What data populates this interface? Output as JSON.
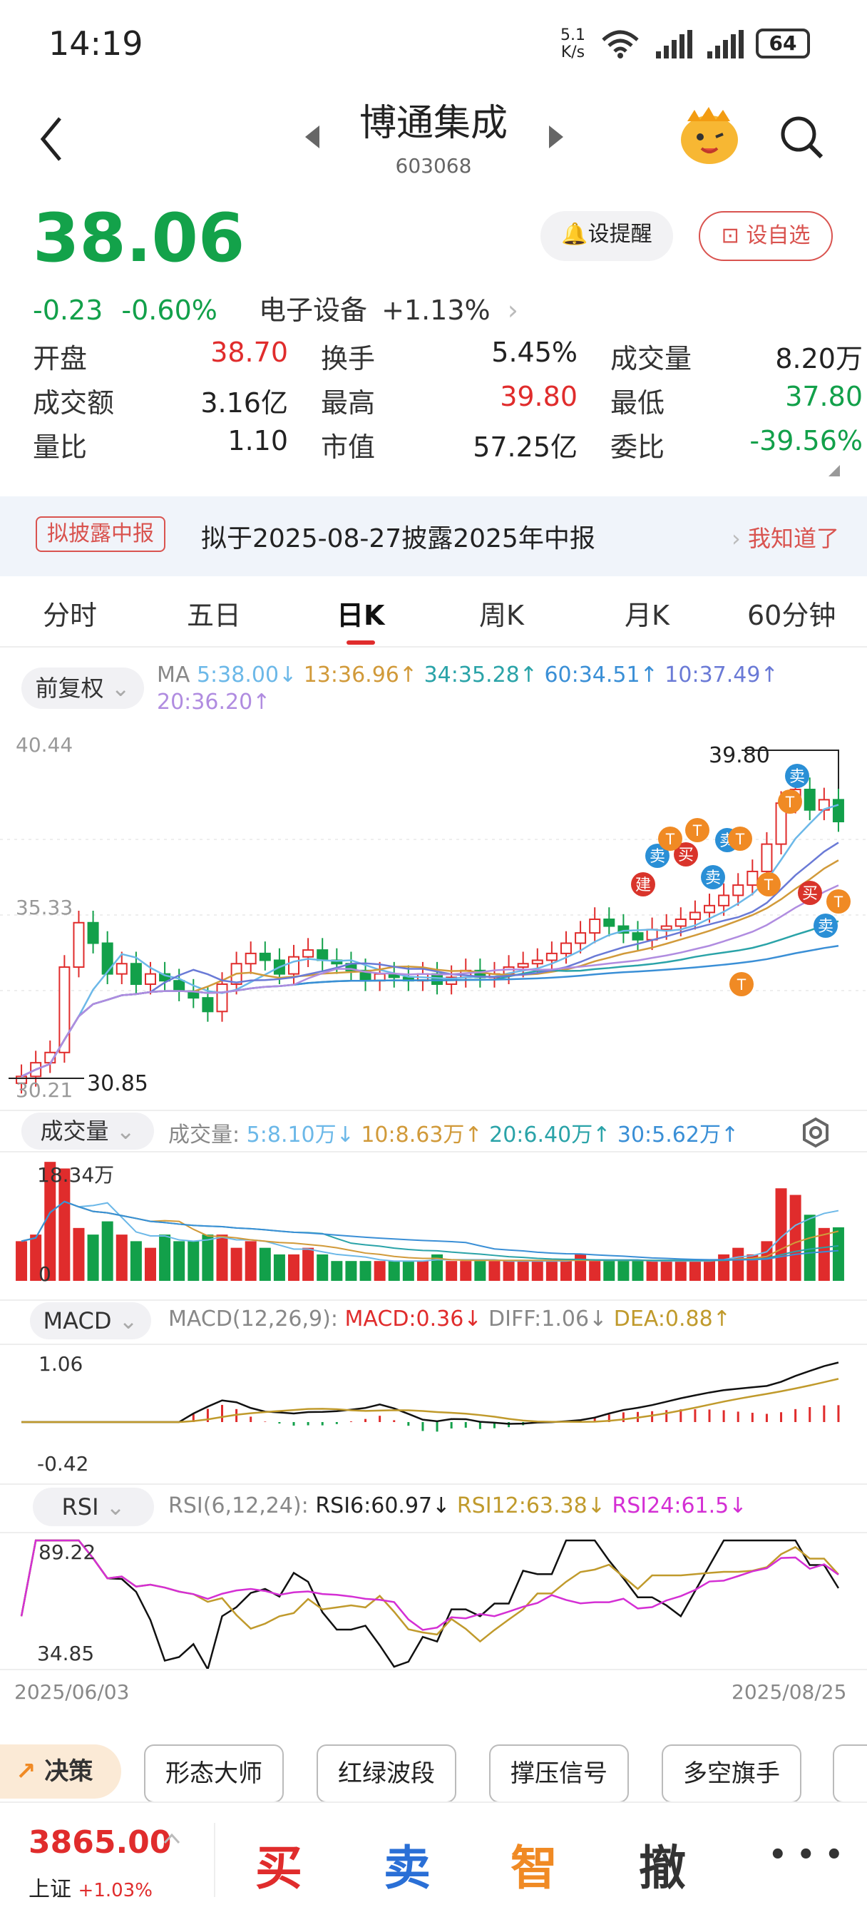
{
  "status_bar": {
    "time": "14:19",
    "net_speed": "5.1",
    "net_unit": "K/s",
    "battery": "64"
  },
  "header": {
    "name": "博通集成",
    "code": "603068"
  },
  "quote": {
    "price": "38.06",
    "change": "-0.23",
    "change_pct": "-0.60%",
    "sector": "电子设备",
    "sector_change": "+1.13%",
    "alert_label": "设提醒",
    "watch_label": "设自选",
    "rows": [
      [
        {
          "label": "开盘",
          "value": "38.70",
          "tone": "red"
        },
        {
          "label": "换手",
          "value": "5.45%",
          "tone": ""
        },
        {
          "label": "成交量",
          "value": "8.20万",
          "tone": ""
        }
      ],
      [
        {
          "label": "成交额",
          "value": "3.16亿",
          "tone": ""
        },
        {
          "label": "最高",
          "value": "39.80",
          "tone": "red"
        },
        {
          "label": "最低",
          "value": "37.80",
          "tone": "green"
        }
      ],
      [
        {
          "label": "量比",
          "value": "1.10",
          "tone": ""
        },
        {
          "label": "市值",
          "value": "57.25亿",
          "tone": ""
        },
        {
          "label": "委比",
          "value": "-39.56%",
          "tone": "green"
        }
      ]
    ]
  },
  "notice": {
    "badge": "拟披露中报",
    "text": "拟于2025-08-27披露2025年中报",
    "action": "我知道了"
  },
  "tabs": [
    "分时",
    "五日",
    "日K",
    "周K",
    "月K",
    "60分钟"
  ],
  "active_tab": "日K",
  "kline": {
    "adjust": "前复权",
    "ma_label": "MA",
    "ma": [
      {
        "t": "5:38.00",
        "c": "#6cb8e8"
      },
      {
        "t": "13:36.96",
        "c": "#d19a3a"
      },
      {
        "t": "34:35.28",
        "c": "#2aa3a8"
      },
      {
        "t": "60:34.51",
        "c": "#3a8fd6"
      },
      {
        "t": "10:37.49",
        "c": "#6a7ad6"
      },
      {
        "t": "20:36.20",
        "c": "#b08ce0"
      }
    ],
    "y_top": "40.44",
    "y_mid": "35.33",
    "y_bot": "30.21",
    "high_label": "39.80",
    "low_label": "30.85",
    "markers": [
      "建",
      "卖",
      "买",
      "T",
      "T",
      "卖",
      "卖",
      "T",
      "卖",
      "T",
      "T",
      "买",
      "卖",
      "T",
      "T"
    ]
  },
  "volume": {
    "label": "成交量",
    "prefix": "成交量:",
    "items": [
      {
        "t": "5:8.10万",
        "c": "#6cb8e8"
      },
      {
        "t": "10:8.63万",
        "c": "#d19a3a"
      },
      {
        "t": "20:6.40万",
        "c": "#2aa3a8"
      },
      {
        "t": "30:5.62万",
        "c": "#3a8fd6"
      }
    ],
    "max": "18.34万",
    "zero": "0"
  },
  "macd": {
    "label": "MACD",
    "params": "MACD(12,26,9):",
    "macd": "MACD:0.36",
    "diff": "DIFF:1.06",
    "dea": "DEA:0.88",
    "top": "1.06",
    "bottom": "-0.42"
  },
  "rsi": {
    "label": "RSI",
    "params": "RSI(6,12,24):",
    "r6": "RSI6:60.97",
    "r12": "RSI12:63.38",
    "r24": "RSI24:61.5",
    "top": "89.22",
    "bottom": "34.85"
  },
  "dates": {
    "start": "2025/06/03",
    "end": "2025/08/25"
  },
  "tools": {
    "decision": "决策",
    "items": [
      "形态大师",
      "红绿波段",
      "撑压信号",
      "多空旗手"
    ]
  },
  "bottom": {
    "index_value": "3865.00",
    "index_name": "上证",
    "index_change": "+1.03%",
    "buy": "买",
    "sell": "卖",
    "smart": "智",
    "cancel": "撤",
    "more": "• • •"
  },
  "chart_data": {
    "type": "candlestick",
    "note_dates": [
      "2025/06/03",
      "2025/08/25"
    ],
    "ylim": [
      30.21,
      40.44
    ],
    "high": 39.8,
    "low": 30.85
  }
}
